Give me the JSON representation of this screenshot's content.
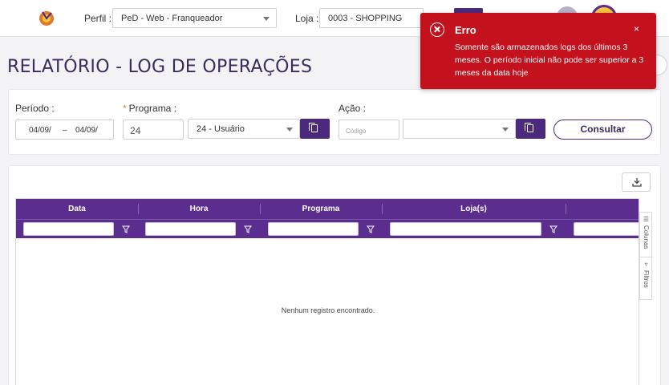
{
  "header": {
    "perfil_label": "Perfil :",
    "perfil_value": "PeD - Web - Franqueador",
    "loja_label": "Loja :",
    "loja_value": "0003 -  SHOPPING",
    "logo_icon": "app-logo-icon",
    "brand_color": "#4b2a7e"
  },
  "page": {
    "title": "RELATÓRIO - LOG DE OPERAÇÕES"
  },
  "filters": {
    "periodo_label": "Período :",
    "date_start": "04/09/",
    "date_sep": "–",
    "date_end": "04/09/",
    "programa_label": "Programa :",
    "programa_required": "*",
    "programa_code": "24",
    "programa_select": "24 - Usuário",
    "acao_label": "Ação :",
    "acao_code_placeholder": "Código",
    "acao_select": "",
    "consultar_label": "Consultar"
  },
  "grid": {
    "columns": [
      "Data",
      "Hora",
      "Programa",
      "Loja(s)"
    ],
    "empty_message": "Nenhum registro encontrado.",
    "side_tabs": [
      "Colunas",
      "Filtros"
    ],
    "header_color": "#5b2d8f"
  },
  "toast": {
    "title": "Erro",
    "close": "×",
    "message": "Somente são armazenados logs dos últimos 3 meses. O período inicial não pode ser superior a 3 meses da data hoje",
    "color": "#c3121e"
  }
}
